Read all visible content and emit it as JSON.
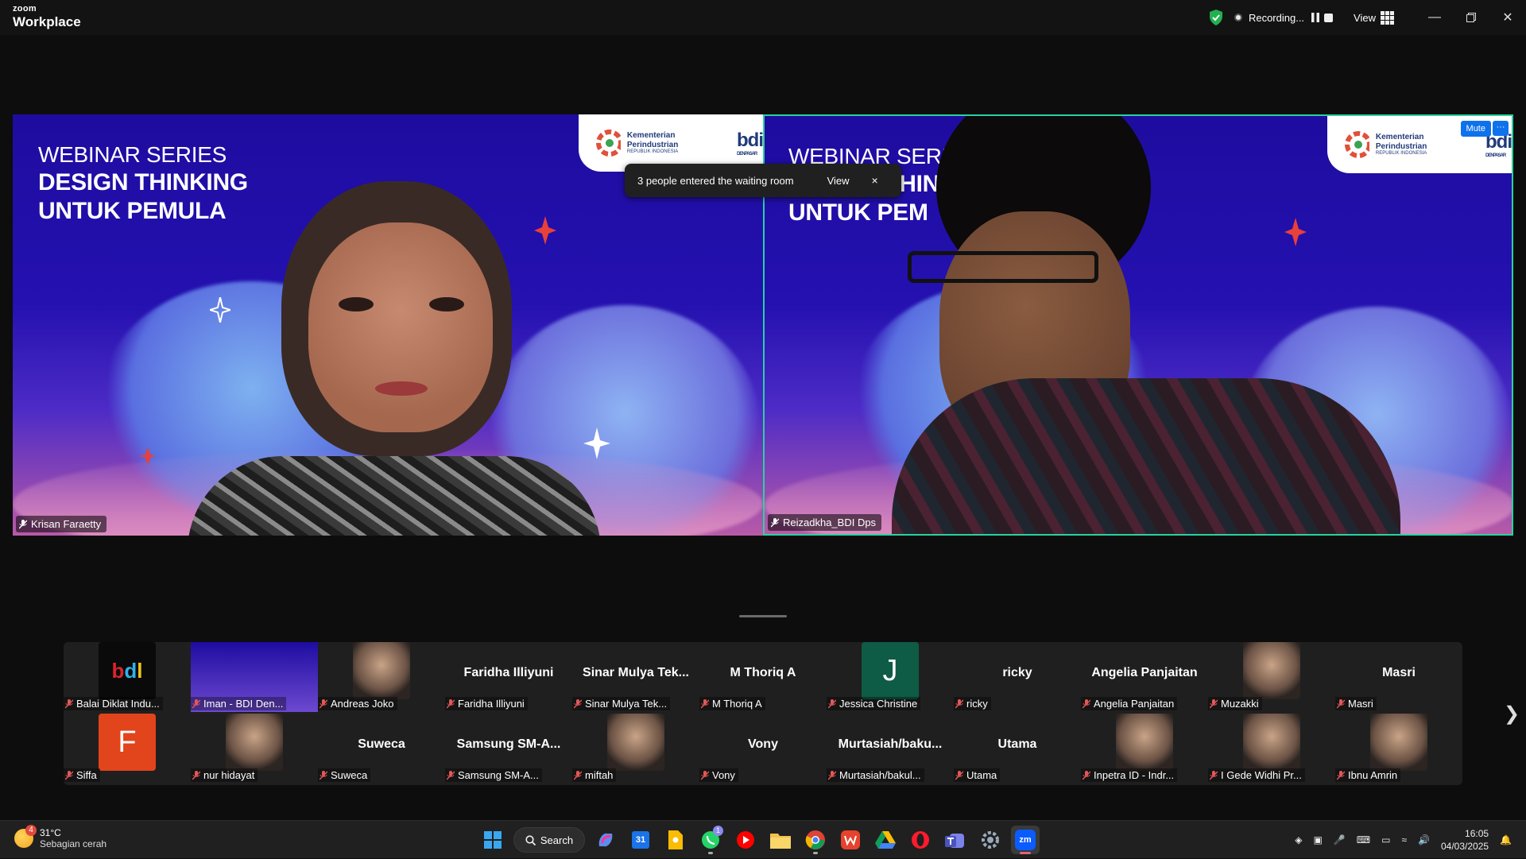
{
  "titlebar": {
    "brand_small": "zoom",
    "brand_big": "Workplace",
    "recording_label": "Recording...",
    "view_label": "View"
  },
  "colors": {
    "accent_blue": "#0e72ed",
    "active_speaker_border": "#27d3a0",
    "stage_bg": "#1b0f7e"
  },
  "videos": [
    {
      "name": "Krisan Faraetty",
      "slide_line1": "WEBINAR SERIES",
      "slide_line2": "DESIGN THINKING",
      "slide_line3": "UNTUK PEMULA",
      "logo_text": "Kementerian Perindustrian",
      "logo_sub": "REPUBLIK INDONESIA",
      "bdi_logo": "bdi",
      "bdi_sub": "DENPASAR"
    },
    {
      "name": "Reizadkha_BDI Dps",
      "slide_line1": "WEBINAR SERI",
      "slide_line2": "DESIGN THIN",
      "slide_line3": "UNTUK PEM",
      "logo_text": "Kementerian Perindustrian",
      "logo_sub": "REPUBLIK INDONESIA",
      "bdi_logo": "bdi",
      "bdi_sub": "DENPASAR",
      "mute_label": "Mute",
      "more_label": "···"
    }
  ],
  "toast": {
    "message": "3 people entered the waiting room",
    "view_label": "View",
    "close_label": "×"
  },
  "participants_row1": [
    {
      "label": "Balai Diklat Indu...",
      "center": "",
      "thumb": "bdi-logo"
    },
    {
      "label": "Iman - BDI Den...",
      "center": "",
      "thumb": "slide"
    },
    {
      "label": "Andreas Joko",
      "center": "",
      "thumb": "photo"
    },
    {
      "label": "Faridha Illiyuni",
      "center": "Faridha Illiyuni",
      "thumb": ""
    },
    {
      "label": "Sinar Mulya Tek...",
      "center": "Sinar  Mulya  Tek...",
      "thumb": ""
    },
    {
      "label": "M Thoriq A",
      "center": "M Thoriq A",
      "thumb": ""
    },
    {
      "label": "Jessica Christine",
      "center": "",
      "thumb": "letter-J"
    },
    {
      "label": "ricky",
      "center": "ricky",
      "thumb": ""
    },
    {
      "label": "Angelia Panjaitan",
      "center": "Angelia Panjaitan",
      "thumb": ""
    },
    {
      "label": "Muzakki",
      "center": "",
      "thumb": "photo"
    },
    {
      "label": "Masri",
      "center": "Masri",
      "thumb": ""
    }
  ],
  "participants_row2": [
    {
      "label": "Siffa",
      "center": "",
      "thumb": "letter-F"
    },
    {
      "label": "nur hidayat",
      "center": "",
      "thumb": "photo"
    },
    {
      "label": "Suweca",
      "center": "Suweca",
      "thumb": ""
    },
    {
      "label": "Samsung SM-A...",
      "center": "Samsung  SM-A...",
      "thumb": ""
    },
    {
      "label": "miftah",
      "center": "",
      "thumb": "photo"
    },
    {
      "label": "Vony",
      "center": "Vony",
      "thumb": ""
    },
    {
      "label": "Murtasiah/bakul...",
      "center": "Murtasiah/baku...",
      "thumb": ""
    },
    {
      "label": "Utama",
      "center": "Utama",
      "thumb": ""
    },
    {
      "label": "Inpetra ID - Indr...",
      "center": "",
      "thumb": "photo"
    },
    {
      "label": "I Gede Widhi Pr...",
      "center": "",
      "thumb": "photo"
    },
    {
      "label": "Ibnu Amrin",
      "center": "",
      "thumb": "photo"
    }
  ],
  "letters": {
    "J": "J",
    "F": "F"
  },
  "taskbar": {
    "temperature": "31°C",
    "weather_desc": "Sebagian cerah",
    "weather_badge": "4",
    "search_label": "Search",
    "calendar_day": "31",
    "whatsapp_badge": "1",
    "time": "16:05",
    "date": "04/03/2025"
  }
}
